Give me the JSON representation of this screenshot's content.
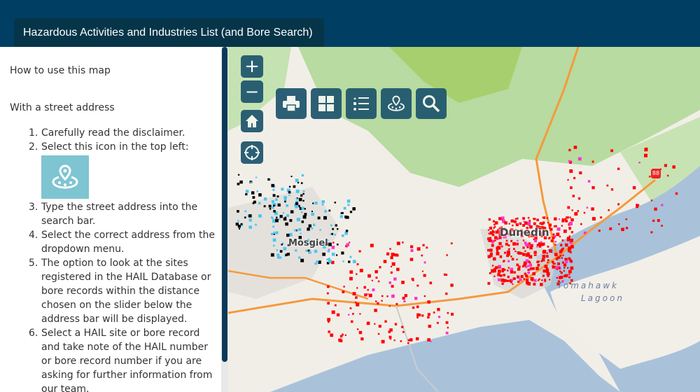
{
  "header": {
    "tab_label": "Hazardous Activities and Industries List (and Bore Search)"
  },
  "panel": {
    "heading": "How to use this map",
    "subheading": "With a street address",
    "steps": [
      {
        "n": "1.",
        "text": "Carefully read the disclaimer."
      },
      {
        "n": "2.",
        "text": "Select this icon in the top left:"
      },
      {
        "n": "3.",
        "text": "Type the street address into the search bar."
      },
      {
        "n": "4.",
        "text": "Select the correct address from the dropdown menu."
      },
      {
        "n": "5.",
        "text": "The option to look at the sites registered in the HAIL Database or bore records within the distance chosen on the slider below the address bar will be displayed."
      },
      {
        "n": "6.",
        "text": "Select a HAIL site or bore record and take note of the HAIL number or bore record number if you are asking for further information from our team."
      }
    ],
    "help_icon": "location-radius-icon",
    "help_icon_color": "#7fc4d1"
  },
  "map": {
    "labels": {
      "city": "Dunedin",
      "town": "Mosgiel",
      "lagoon1": "Tomahawk",
      "lagoon2": "Lagoon",
      "shield": "88"
    },
    "controls": {
      "zoom_in": "+",
      "zoom_out": "−",
      "home": "home-icon",
      "locate": "crosshair-icon"
    },
    "toolbar": [
      "print-icon",
      "basemap-gallery-icon",
      "legend-list-icon",
      "nearby-search-icon",
      "search-icon"
    ],
    "colors": {
      "button": "#22586f",
      "hail_sites": "#ff0000",
      "roads": "#f59a3c",
      "water": "#a9c2da",
      "parks": "#b7dba0"
    }
  }
}
